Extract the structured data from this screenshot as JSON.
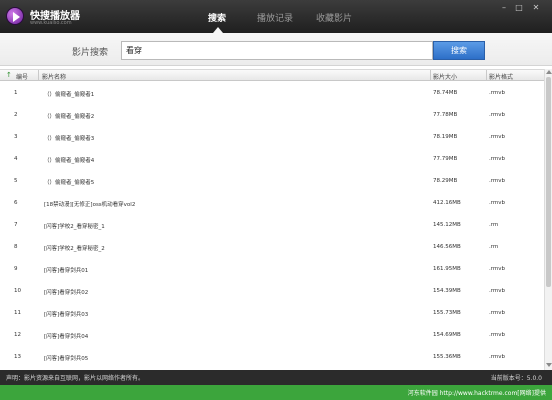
{
  "app": {
    "title": "快搜播放器",
    "subtitle": "www.kuaiso.com",
    "icon": "play-logo-icon",
    "brand_color": "#7b2fa8"
  },
  "tabs": [
    {
      "label": "搜索",
      "active": true
    },
    {
      "label": "播放记录",
      "active": false
    },
    {
      "label": "收藏影片",
      "active": false
    }
  ],
  "window_controls": {
    "minimize": "–",
    "maximize": "□",
    "close": "✕"
  },
  "search": {
    "label": "影片搜索",
    "value": "看穿",
    "button_label": "搜索",
    "button_color": "#2d6fc8"
  },
  "table": {
    "columns": [
      "编号",
      "影片名称",
      "影片大小",
      "影片格式"
    ],
    "rows": [
      {
        "idx": "1",
        "name": "（）偷窥者_偷窥者1",
        "size": "78.74MB",
        "format": ".rmvb"
      },
      {
        "idx": "2",
        "name": "（）偷窥者_偷窥者2",
        "size": "77.78MB",
        "format": ".rmvb"
      },
      {
        "idx": "3",
        "name": "（）偷窥者_偷窥者3",
        "size": "78.19MB",
        "format": ".rmvb"
      },
      {
        "idx": "4",
        "name": "（）偷窥者_偷窥者4",
        "size": "77.79MB",
        "format": ".rmvb"
      },
      {
        "idx": "5",
        "name": "（）偷窥者_偷窥者5",
        "size": "78.29MB",
        "format": ".rmvb"
      },
      {
        "idx": "6",
        "name": "[18禁动漫][无修正]oss机动看穿vol2",
        "size": "412.16MB",
        "format": ".rmvb"
      },
      {
        "idx": "7",
        "name": "[闪客]学校2_看穿秘密_1",
        "size": "145.12MB",
        "format": ".rm"
      },
      {
        "idx": "8",
        "name": "[闪客]学校2_看穿秘密_2",
        "size": "146.56MB",
        "format": ".rm"
      },
      {
        "idx": "9",
        "name": "[闪客]看穿剑兵01",
        "size": "161.95MB",
        "format": ".rmvb"
      },
      {
        "idx": "10",
        "name": "[闪客]看穿剑兵02",
        "size": "154.39MB",
        "format": ".rmvb"
      },
      {
        "idx": "11",
        "name": "[闪客]看穿剑兵03",
        "size": "155.73MB",
        "format": ".rmvb"
      },
      {
        "idx": "12",
        "name": "[闪客]看穿剑兵04",
        "size": "154.69MB",
        "format": ".rmvb"
      },
      {
        "idx": "13",
        "name": "[闪客]看穿剑兵05",
        "size": "155.36MB",
        "format": ".rmvb"
      }
    ]
  },
  "status": {
    "left": "声明：影片资源来自互联网，影片以网络作者所有。",
    "right": "当前版本号：5.0.0"
  },
  "banner": {
    "text": "河东软件园 http://www.hacktrme.com[网络]提供",
    "color": "#3ca53c"
  }
}
